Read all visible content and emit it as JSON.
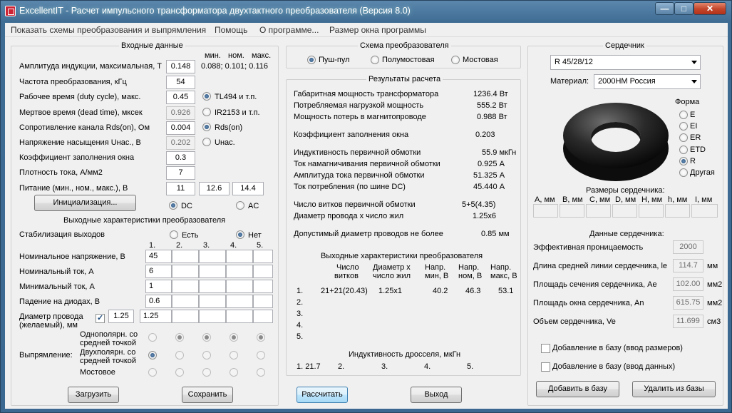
{
  "window": {
    "title": "ExcellentIT - Расчет импульсного трансформатора двухтактного преобразователя (Версия 8.0)",
    "min": "—",
    "max": "□",
    "close": "✕"
  },
  "menu": [
    "Показать схемы преобразования и выпрямления",
    "Помощь",
    "О программе...",
    "Размер окна программы"
  ],
  "input": {
    "title": "Входные данные",
    "hdr_min": "мин.",
    "hdr_nom": "ном.",
    "hdr_max": "макс.",
    "amp_label": "Амплитуда индукции, максимальная, Т",
    "amp_value": "0.148",
    "amp_range": "0.088; 0.101; 0.116",
    "freq_label": "Частота преобразования, кГц",
    "freq_value": "54",
    "duty_label": "Рабочее время (duty cycle), макс.",
    "duty_value": "0.45",
    "dead_label": "Мертвое время (dead time), мксек",
    "dead_value": "0.926",
    "rds_label": "Сопротивление канала Rds(on), Ом",
    "rds_value": "0.004",
    "usat_label": "Напряжение насыщения Uнас., В",
    "usat_value": "0.202",
    "fill_label": "Коэффициент заполнения окна",
    "fill_value": "0.3",
    "density_label": "Плотность тока, А/мм2",
    "density_value": "7",
    "supply_label": "Питание (мин., ном., макс.), В",
    "supply_min": "11",
    "supply_nom": "12.6",
    "supply_max": "14.4",
    "ctrl_tl494": "TL494 и т.п.",
    "ctrl_ir2153": "IR2153 и т.п.",
    "sw_rds": "Rds(on)",
    "sw_usat": "Uнас.",
    "init_button": "Инициализация...",
    "dc": "DC",
    "ac": "AC"
  },
  "outputs": {
    "title": "Выходные характеристики преобразователя",
    "stab_label": "Стабилизация выходов",
    "stab_yes": "Есть",
    "stab_no": "Нет",
    "cols": [
      "1.",
      "2.",
      "3.",
      "4.",
      "5."
    ],
    "voltage_label": "Номинальное напряжение, В",
    "voltage": [
      "45",
      "",
      "",
      "",
      ""
    ],
    "current_label": "Номинальный ток, А",
    "current": [
      "6",
      "",
      "",
      "",
      ""
    ],
    "min_current_label": "Минимальный ток, А",
    "min_current": [
      "1",
      "",
      "",
      "",
      ""
    ],
    "diode_label": "Падение на диодах, В",
    "diode": [
      "0.6",
      "",
      "",
      "",
      ""
    ],
    "wire_label1": "Диаметр провода",
    "wire_label2": "(желаемый), мм",
    "wire_global": "1.25",
    "wire": [
      "1.25",
      "",
      "",
      "",
      ""
    ],
    "rect_label": "Выпрямление:",
    "rect_opt1a": "Однополярн. со",
    "rect_opt1b": "средней точкой",
    "rect_opt2a": "Двухполярн. со",
    "rect_opt2b": "средней точкой",
    "rect_opt3": "Мостовое",
    "load_button": "Загрузить",
    "save_button": "Сохранить"
  },
  "scheme": {
    "title": "Схема преобразователя",
    "push_pull": "Пуш-пул",
    "half_bridge": "Полумостовая",
    "bridge": "Мостовая"
  },
  "results": {
    "title": "Результаты расчета",
    "rows": [
      {
        "label": "Габаритная мощность трансформатора",
        "value": "1236.4 Вт"
      },
      {
        "label": "Потребляемая нагрузкой мощность",
        "value": "555.2 Вт"
      },
      {
        "label": "Мощность потерь в магнитопроводе",
        "value": "0.988 Вт"
      },
      {
        "label": "Коэффициент заполнения окна",
        "value": "0.203"
      },
      {
        "label": "Индуктивность первичной обмотки",
        "value": "55.9 мкГн"
      },
      {
        "label": "Ток намагничивания первичной обмотки",
        "value": "0.925 А"
      },
      {
        "label": "Амплитуда тока первичной обмотки",
        "value": "51.325 А"
      },
      {
        "label": "Ток потребления (по шине DC)",
        "value": "45.440 А"
      },
      {
        "label": "Число витков первичной обмотки",
        "value": "5+5(4.35)"
      },
      {
        "label": "Диаметр провода х число жил",
        "value": "1.25х6"
      },
      {
        "label": "Допустимый диаметр проводов не более",
        "value": "0.85 мм"
      }
    ],
    "out_title": "Выходные характеристики преобразователя",
    "col_turns_a": "Число",
    "col_turns_b": "витков",
    "col_wire_a": "Диаметр х",
    "col_wire_b": "число жил",
    "col_vmin_a": "Напр.",
    "col_vmin_b": "мин, В",
    "col_vnom_a": "Напр.",
    "col_vnom_b": "ном, В",
    "col_vmax_a": "Напр.",
    "col_vmax_b": "макс, В",
    "out_rows": [
      {
        "n": "1.",
        "turns": "21+21(20.43)",
        "wire": "1.25х1",
        "vmin": "40.2",
        "vnom": "46.3",
        "vmax": "53.1"
      },
      {
        "n": "2.",
        "turns": "",
        "wire": "",
        "vmin": "",
        "vnom": "",
        "vmax": ""
      },
      {
        "n": "3.",
        "turns": "",
        "wire": "",
        "vmin": "",
        "vnom": "",
        "vmax": ""
      },
      {
        "n": "4.",
        "turns": "",
        "wire": "",
        "vmin": "",
        "vnom": "",
        "vmax": ""
      },
      {
        "n": "5.",
        "turns": "",
        "wire": "",
        "vmin": "",
        "vnom": "",
        "vmax": ""
      }
    ],
    "choke_title": "Индуктивность дросселя, мкГн",
    "choke": [
      "1. 21.7",
      "2.",
      "3.",
      "4.",
      "5."
    ],
    "calc_button": "Рассчитать",
    "exit_button": "Выход"
  },
  "core": {
    "title": "Сердечник",
    "selected": "R 45/28/12",
    "material_label": "Материал:",
    "material": "2000НМ Россия",
    "shape_title": "Форма",
    "shapes": [
      "E",
      "EI",
      "ER",
      "ETD",
      "R",
      "Другая"
    ],
    "dims_title": "Размеры сердечника:",
    "dims": [
      "А, мм",
      "B, мм",
      "C, мм",
      "D, мм",
      "H, мм",
      "h, мм",
      "I, мм"
    ],
    "data_title": "Данные сердечника:",
    "perm_label": "Эффективная проницаемость",
    "perm_value": "2000",
    "le_label": "Длина средней линии сердечника, le",
    "le_value": "114.7",
    "le_unit": "мм",
    "ae_label": "Площадь сечения сердечника, Ae",
    "ae_value": "102.00",
    "ae_unit": "мм2",
    "an_label": "Площадь окна сердечника, An",
    "an_value": "615.75",
    "an_unit": "мм2",
    "ve_label": "Объем сердечника, Ve",
    "ve_value": "11.699",
    "ve_unit": "см3",
    "add_dims": "Добавление в базу (ввод размеров)",
    "add_data": "Добавление в базу (ввод данных)",
    "add_button": "Добавить в базу",
    "del_button": "Удалить из базы"
  }
}
